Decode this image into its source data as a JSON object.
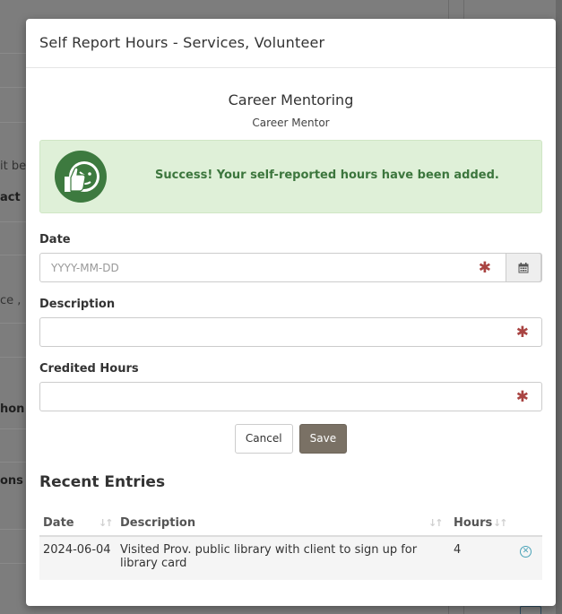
{
  "background": {
    "fragments": [
      {
        "text": "it be",
        "bold": false
      },
      {
        "text": "act",
        "bold": true
      },
      {
        "text": "ce ,",
        "bold": false
      },
      {
        "text": "hon",
        "bold": true
      },
      {
        "text": "ons",
        "bold": true
      }
    ]
  },
  "modal": {
    "title": "Self Report Hours - Services, Volunteer",
    "service_name": "Career Mentoring",
    "service_role": "Career Mentor"
  },
  "alert": {
    "message": "Success! Your self-reported hours have been added.",
    "icon": "thumbs-up-smiley-icon",
    "color": "#3c763d",
    "background": "#dff0d8"
  },
  "form": {
    "date": {
      "label": "Date",
      "placeholder": "YYYY-MM-DD",
      "value": "",
      "required_mark": "✱",
      "icon": "calendar-icon"
    },
    "description": {
      "label": "Description",
      "placeholder": "",
      "value": "",
      "required_mark": "✱"
    },
    "hours": {
      "label": "Credited Hours",
      "placeholder": "",
      "value": "",
      "required_mark": "✱"
    },
    "cancel_label": "Cancel",
    "save_label": "Save"
  },
  "recent": {
    "title": "Recent Entries",
    "columns": [
      "Date",
      "Description",
      "Hours"
    ],
    "rows": [
      {
        "date": "2024-06-04",
        "description": "Visited Prov. public library with client to sign up for library card",
        "hours": "4",
        "remove_icon": "remove-circle-icon"
      }
    ]
  }
}
